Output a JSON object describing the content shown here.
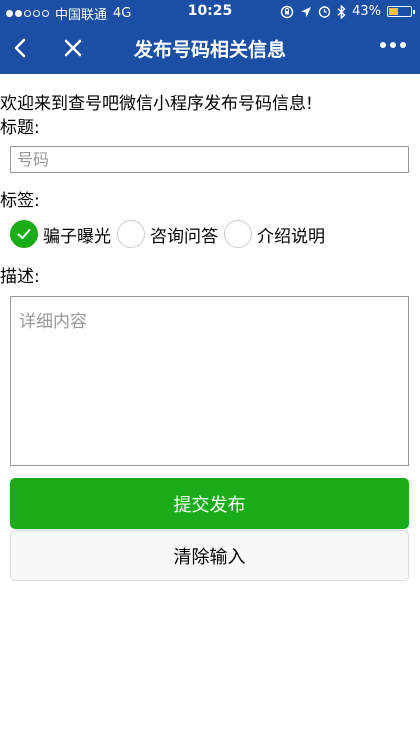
{
  "status_bar": {
    "carrier": "中国联通",
    "network": "4G",
    "time": "10:25",
    "battery": "43%",
    "battery_level": 0.43,
    "signal_bars": 2,
    "icons": [
      "orientation-lock-icon",
      "location-icon",
      "alarm-icon",
      "bluetooth-icon",
      "battery-icon"
    ]
  },
  "nav": {
    "title": "发布号码相关信息",
    "back_icon": "back-arrow-icon",
    "close_icon": "close-icon",
    "more_icon": "more-icon"
  },
  "form": {
    "welcome": "欢迎来到查号吧微信小程序发布号码信息!",
    "title_label": "标题:",
    "title_placeholder": "号码",
    "tags_label": "标签:",
    "tags": [
      {
        "label": "骗子曝光",
        "checked": true
      },
      {
        "label": "咨询问答",
        "checked": false
      },
      {
        "label": "介绍说明",
        "checked": false
      }
    ],
    "desc_label": "描述:",
    "desc_placeholder": "详细内容",
    "submit_label": "提交发布",
    "clear_label": "清除输入"
  },
  "colors": {
    "header_bg": "#1b4ea5",
    "primary_green": "#1aad19",
    "clear_bg": "#f8f8f8"
  }
}
